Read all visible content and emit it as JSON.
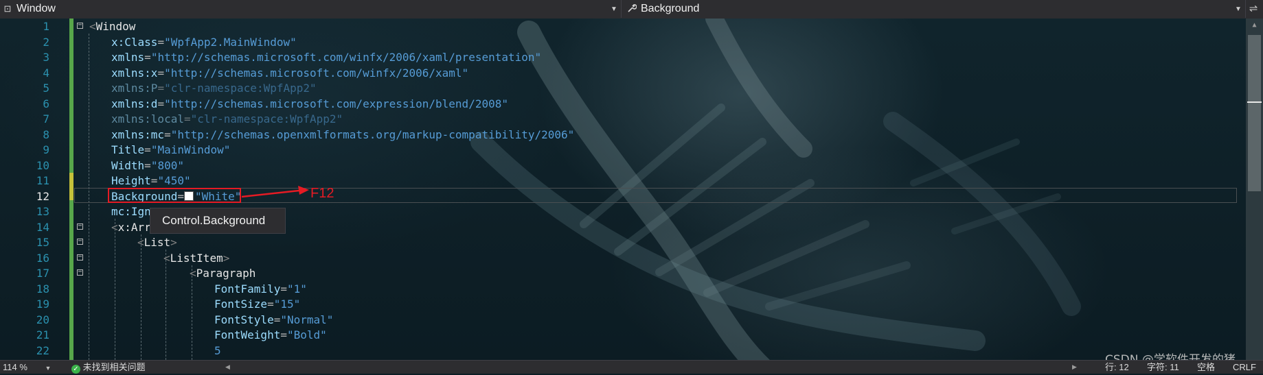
{
  "nav": {
    "left_label": "Window",
    "right_label": "Background"
  },
  "lines": [
    {
      "n": "1",
      "parts": [
        [
          "br",
          "<"
        ],
        [
          "el",
          "Window"
        ]
      ]
    },
    {
      "n": "2",
      "parts": [
        [
          "at",
          "x:Class"
        ],
        [
          "eq",
          "="
        ],
        [
          "st",
          "\"WpfApp2.MainWindow\""
        ]
      ]
    },
    {
      "n": "3",
      "parts": [
        [
          "at",
          "xmlns"
        ],
        [
          "eq",
          "="
        ],
        [
          "st",
          "\"http://schemas.microsoft.com/winfx/2006/xaml/presentation\""
        ]
      ]
    },
    {
      "n": "4",
      "parts": [
        [
          "at",
          "xmlns:x"
        ],
        [
          "eq",
          "="
        ],
        [
          "st",
          "\"http://schemas.microsoft.com/winfx/2006/xaml\""
        ]
      ]
    },
    {
      "n": "5",
      "dim": true,
      "parts": [
        [
          "at",
          "xmlns:P"
        ],
        [
          "eq",
          "="
        ],
        [
          "st",
          "\"clr-namespace:WpfApp2\""
        ]
      ]
    },
    {
      "n": "6",
      "parts": [
        [
          "at",
          "xmlns:d"
        ],
        [
          "eq",
          "="
        ],
        [
          "st",
          "\"http://schemas.microsoft.com/expression/blend/2008\""
        ]
      ]
    },
    {
      "n": "7",
      "dim": true,
      "parts": [
        [
          "at",
          "xmlns:local"
        ],
        [
          "eq",
          "="
        ],
        [
          "st",
          "\"clr-namespace:WpfApp2\""
        ]
      ]
    },
    {
      "n": "8",
      "parts": [
        [
          "at",
          "xmlns:mc"
        ],
        [
          "eq",
          "="
        ],
        [
          "st",
          "\"http://schemas.openxmlformats.org/markup-compatibility/2006\""
        ]
      ]
    },
    {
      "n": "9",
      "parts": [
        [
          "at",
          "Title"
        ],
        [
          "eq",
          "="
        ],
        [
          "st",
          "\"MainWindow\""
        ]
      ]
    },
    {
      "n": "10",
      "parts": [
        [
          "at",
          "Width"
        ],
        [
          "eq",
          "="
        ],
        [
          "st",
          "\"800\""
        ]
      ]
    },
    {
      "n": "11",
      "parts": [
        [
          "at",
          "Height"
        ],
        [
          "eq",
          "="
        ],
        [
          "st",
          "\"450\""
        ]
      ]
    },
    {
      "n": "12",
      "active": true,
      "parts": [
        [
          "at",
          "Background"
        ],
        [
          "eq",
          "="
        ],
        [
          "swatch",
          ""
        ],
        [
          "st",
          "\"White\""
        ]
      ]
    },
    {
      "n": "13",
      "parts": [
        [
          "at",
          "mc:Ign"
        ]
      ]
    },
    {
      "n": "14",
      "parts": [
        [
          "br",
          "<"
        ],
        [
          "el",
          "x:Arr"
        ]
      ]
    },
    {
      "n": "15",
      "parts": [
        [
          "br",
          "<"
        ],
        [
          "el",
          "List"
        ],
        [
          "br",
          ">"
        ]
      ]
    },
    {
      "n": "16",
      "parts": [
        [
          "br",
          "<"
        ],
        [
          "el",
          "ListItem"
        ],
        [
          "br",
          ">"
        ]
      ]
    },
    {
      "n": "17",
      "parts": [
        [
          "br",
          "<"
        ],
        [
          "el",
          "Paragraph"
        ]
      ]
    },
    {
      "n": "18",
      "parts": [
        [
          "at",
          "FontFamily"
        ],
        [
          "eq",
          "="
        ],
        [
          "st",
          "\"1\""
        ]
      ]
    },
    {
      "n": "19",
      "parts": [
        [
          "at",
          "FontSize"
        ],
        [
          "eq",
          "="
        ],
        [
          "st",
          "\"15\""
        ]
      ]
    },
    {
      "n": "20",
      "parts": [
        [
          "at",
          "FontStyle"
        ],
        [
          "eq",
          "="
        ],
        [
          "st",
          "\"Normal\""
        ]
      ]
    },
    {
      "n": "21",
      "parts": [
        [
          "at",
          "FontWeight"
        ],
        [
          "eq",
          "="
        ],
        [
          "st",
          "\"Bold\""
        ]
      ]
    },
    {
      "n": "22",
      "parts": [
        [
          "st",
          "5"
        ]
      ]
    }
  ],
  "tooltip": "Control.Background",
  "annotation": "F12",
  "status": {
    "zoom": "114 %",
    "issues": "未找到相关问题",
    "row": "行: 12",
    "col": "字符: 11",
    "spaces": "空格",
    "eol": "CRLF"
  },
  "watermark": "CSDN @学软件开发的猪"
}
